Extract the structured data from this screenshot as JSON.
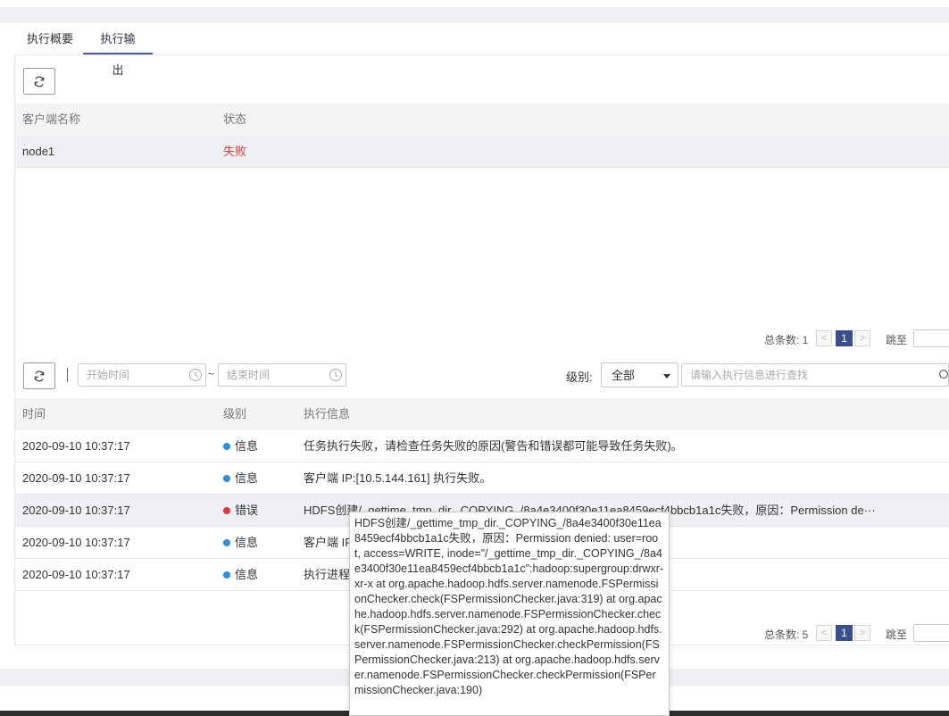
{
  "tabs": [
    {
      "label": "执行概要",
      "active": false
    },
    {
      "label": "执行输出",
      "active": true
    }
  ],
  "clients_table": {
    "headers": {
      "name": "客户端名称",
      "status": "状态"
    },
    "rows": [
      {
        "name": "node1",
        "status": "失败",
        "status_color": "#d64545"
      }
    ],
    "pager": {
      "total_label": "总条数: 1",
      "page": "1",
      "jump_label": "跳至"
    }
  },
  "log_toolbar": {
    "start_placeholder": "开始时间",
    "end_placeholder": "结束时间",
    "range_sep": "~",
    "level_label": "级别:",
    "level_value": "全部",
    "search_placeholder": "请输入执行信息进行查找"
  },
  "log_table": {
    "headers": {
      "time": "时间",
      "level": "级别",
      "info": "执行信息"
    },
    "rows": [
      {
        "time": "2020-09-10 10:37:17",
        "level": "信息",
        "level_type": "info",
        "info": "任务执行失败，请检查任务失败的原因(警告和错误都可能导致任务失败)。"
      },
      {
        "time": "2020-09-10 10:37:17",
        "level": "信息",
        "level_type": "info",
        "info": "客户端 IP:[10.5.144.161] 执行失败。"
      },
      {
        "time": "2020-09-10 10:37:17",
        "level": "错误",
        "level_type": "error",
        "info": "HDFS创建/_gettime_tmp_dir._COPYING_/8a4e3400f30e11ea8459ecf4bbcb1a1c失败，原因：Permission de···"
      },
      {
        "time": "2020-09-10 10:37:17",
        "level": "信息",
        "level_type": "info",
        "info": "客户端 IP"
      },
      {
        "time": "2020-09-10 10:37:17",
        "level": "信息",
        "level_type": "info",
        "info": "执行进程"
      }
    ],
    "pager": {
      "total_label": "总条数: 5",
      "page": "1",
      "jump_label": "跳至"
    }
  },
  "tooltip": {
    "text": "HDFS创建/_gettime_tmp_dir._COPYING_/8a4e3400f30e11ea8459ecf4bbcb1a1c失败，原因：Permission denied: user=root, access=WRITE, inode=\"/_gettime_tmp_dir._COPYING_/8a4e3400f30e11ea8459ecf4bbcb1a1c\":hadoop:supergroup:drwxr-xr-x at org.apache.hadoop.hdfs.server.namenode.FSPermissionChecker.check(FSPermissionChecker.java:319) at org.apache.hadoop.hdfs.server.namenode.FSPermissionChecker.check(FSPermissionChecker.java:292) at org.apache.hadoop.hdfs.server.namenode.FSPermissionChecker.checkPermission(FSPermissionChecker.java:213) at org.apache.hadoop.hdfs.server.namenode.FSPermissionChecker.checkPermission(FSPermissionChecker.java:190)"
  },
  "colors": {
    "accent": "#3d4f8a",
    "info_dot": "#2f8fe0",
    "error_dot": "#d63a3a",
    "fail_text": "#d64545"
  }
}
